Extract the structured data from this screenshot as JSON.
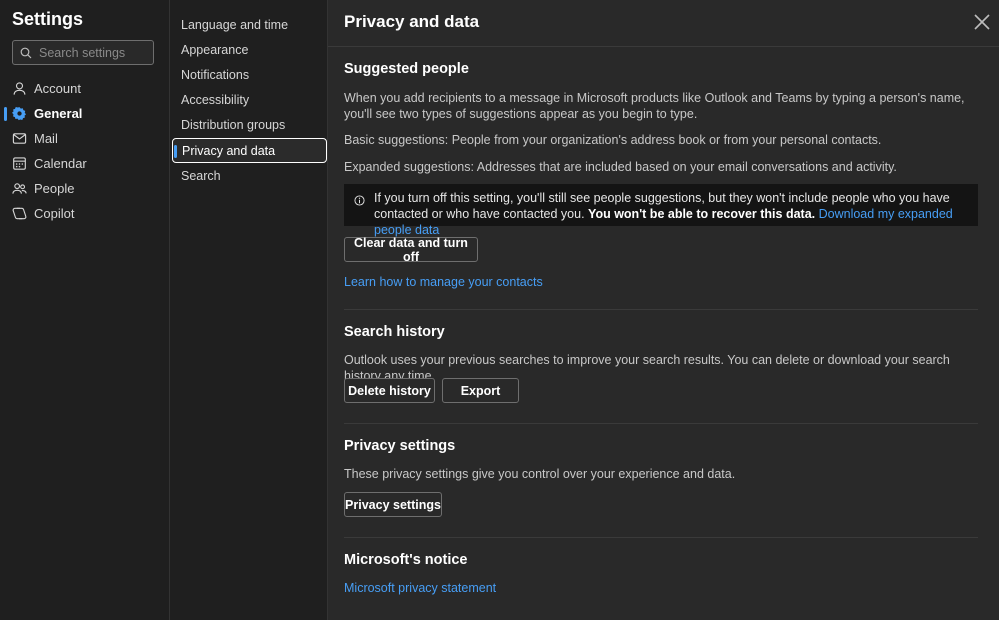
{
  "sidebar": {
    "title": "Settings",
    "search_placeholder": "Search settings",
    "items": [
      {
        "label": "Account",
        "icon": "person-icon"
      },
      {
        "label": "General",
        "icon": "gear-icon",
        "active": true
      },
      {
        "label": "Mail",
        "icon": "mail-icon"
      },
      {
        "label": "Calendar",
        "icon": "calendar-icon"
      },
      {
        "label": "People",
        "icon": "people-icon"
      },
      {
        "label": "Copilot",
        "icon": "copilot-icon"
      }
    ]
  },
  "subnav": {
    "items": [
      {
        "label": "Language and time"
      },
      {
        "label": "Appearance"
      },
      {
        "label": "Notifications"
      },
      {
        "label": "Accessibility"
      },
      {
        "label": "Distribution groups"
      },
      {
        "label": "Privacy and data",
        "active": true
      },
      {
        "label": "Search"
      }
    ]
  },
  "main": {
    "title": "Privacy and data",
    "suggested": {
      "title": "Suggested people",
      "desc": "When you add recipients to a message in Microsoft products like Outlook and Teams by typing a person's name, you'll see two types of suggestions appear as you begin to type.",
      "basic": "Basic suggestions: People from your organization's address book or from your personal contacts.",
      "expanded": "Expanded suggestions: Addresses that are included based on your email conversations and activity.",
      "info_text": "If you turn off this setting, you'll still see people suggestions, but they won't include people who you have contacted or who have contacted you.",
      "info_bold": "You won't be able to recover this data.",
      "info_link": "Download my expanded people data",
      "clear_button": "Clear data and turn off",
      "learn_link": "Learn how to manage your contacts"
    },
    "search_history": {
      "title": "Search history",
      "desc": "Outlook uses your previous searches to improve your search results. You can delete or download your search history any time.",
      "delete_button": "Delete history",
      "export_button": "Export"
    },
    "privacy_settings": {
      "title": "Privacy settings",
      "desc": "These privacy settings give you control over your experience and data.",
      "button": "Privacy settings"
    },
    "notice": {
      "title": "Microsoft's notice",
      "link": "Microsoft privacy statement"
    }
  },
  "colors": {
    "accent": "#479ef5",
    "background": "#1f1f1f",
    "panel": "#292929"
  }
}
